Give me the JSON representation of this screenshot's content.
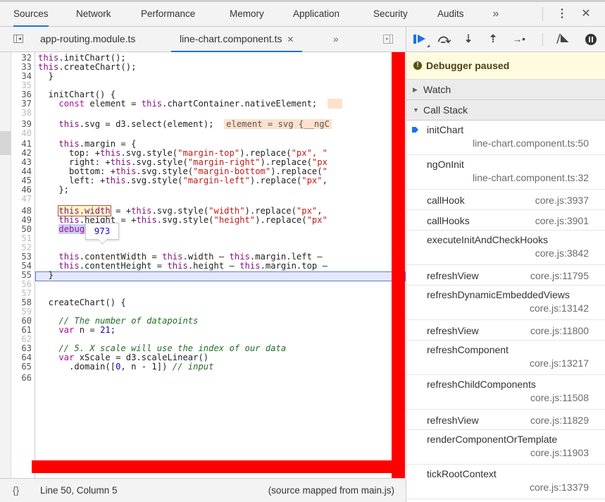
{
  "top_tabs": [
    {
      "label": "Sources",
      "active": true
    },
    {
      "label": "Network",
      "active": false
    },
    {
      "label": "Performance",
      "active": false
    },
    {
      "label": "Memory",
      "active": false
    },
    {
      "label": "Application",
      "active": false
    },
    {
      "label": "Security",
      "active": false
    },
    {
      "label": "Audits",
      "active": false
    }
  ],
  "top_more": "»",
  "top_menu": "⋮",
  "top_close": "✕",
  "file_tabs": [
    {
      "label": "app-routing.module.ts",
      "active": false
    },
    {
      "label": "line-chart.component.ts",
      "active": true,
      "close": "✕"
    }
  ],
  "file_more": "»",
  "editor": {
    "lines": [
      {
        "n": "32",
        "dim": false
      },
      {
        "n": "33",
        "dim": false
      },
      {
        "n": "34",
        "dim": false
      },
      {
        "n": "35",
        "dim": true
      },
      {
        "n": "36",
        "dim": false
      },
      {
        "n": "37",
        "dim": false
      },
      {
        "n": "38",
        "dim": true
      },
      {
        "n": "39",
        "dim": false
      },
      {
        "n": "40",
        "dim": true
      },
      {
        "n": "41",
        "dim": false
      },
      {
        "n": "42",
        "dim": false
      },
      {
        "n": "43",
        "dim": false
      },
      {
        "n": "44",
        "dim": false
      },
      {
        "n": "45",
        "dim": false
      },
      {
        "n": "46",
        "dim": false
      },
      {
        "n": "47",
        "dim": true
      },
      {
        "n": "48",
        "dim": false
      },
      {
        "n": "49",
        "dim": false
      },
      {
        "n": "50",
        "dim": false
      },
      {
        "n": "51",
        "dim": true
      },
      {
        "n": "52",
        "dim": true
      },
      {
        "n": "53",
        "dim": false
      },
      {
        "n": "54",
        "dim": false
      },
      {
        "n": "55",
        "dim": false
      },
      {
        "n": "56",
        "dim": true
      },
      {
        "n": "57",
        "dim": true
      },
      {
        "n": "58",
        "dim": false
      },
      {
        "n": "59",
        "dim": true
      },
      {
        "n": "60",
        "dim": false
      },
      {
        "n": "61",
        "dim": false
      },
      {
        "n": "62",
        "dim": true
      },
      {
        "n": "63",
        "dim": false
      },
      {
        "n": "64",
        "dim": false
      },
      {
        "n": "65",
        "dim": false
      },
      {
        "n": "66",
        "dim": false
      }
    ],
    "code": {
      "l32": "    this.initChart();",
      "l33": "    this.createChart();",
      "l34": "  }",
      "l36": "  initChart() {",
      "l37_a": "    const element = this.chartContainer.nativeElement;",
      "l37_val": "  ",
      "l39_a": "    this.svg = d3.select(element);",
      "l39_val": "element = svg {__ngC",
      "l41": "    this.margin = {",
      "l42_a": "      top: +this.svg.style(",
      "l42_s": "\"margin-top\"",
      "l42_b": ").replace(",
      "l42_s2": "\"px\", \"",
      "l43_a": "      right: +this.svg.style(",
      "l43_s": "\"margin-right\"",
      "l43_b": ").replace(",
      "l43_s2": "\"px",
      "l44_a": "      bottom: +this.svg.style(",
      "l44_s": "\"margin-bottom\"",
      "l44_b": ").replace(",
      "l44_s2": "\"",
      "l45_a": "      left: +this.svg.style(",
      "l45_s": "\"margin-left\"",
      "l45_b": ").replace(",
      "l45_s2": "\"px\"",
      "l45_c": ",",
      "l46": "    };",
      "l48_hover": "this.width",
      "l48_a": " = +this.svg.style(",
      "l48_s": "\"width\"",
      "l48_b": ").replace(",
      "l48_s2": "\"px\"",
      "l48_c": ", ",
      "l49_a": "    this.height = +this.svg.style(",
      "l49_s": "\"height\"",
      "l49_b": ").replace(",
      "l49_s2": "\"px\"",
      "l50": "debugger",
      "l53": "    this.contentWidth = this.width - this.margin.left - ",
      "l54": "    this.contentHeight = this.height - this.margin.top - ",
      "l55": "  }",
      "l58": "  createChart() {",
      "l60": "    // The number of datapoints",
      "l61_a": "    var n = ",
      "l61_n": "21",
      "l61_b": ";",
      "l63": "    // 5. X scale will use the index of our data",
      "l64": "    var xScale = d3.scaleLinear()",
      "l65_a": "      .domain([",
      "l65_n": "0",
      "l65_b": ", n - 1]) ",
      "l65_c": "// input"
    },
    "tooltip_value": "973"
  },
  "status": {
    "braces": "{}",
    "position": "Line 50, Column 5",
    "source_map": "(source mapped from main.js)"
  },
  "debugger": {
    "paused_message": "Debugger paused",
    "watch_label": "Watch",
    "callstack_label": "Call Stack",
    "frames": [
      {
        "name": "initChart",
        "loc": "line-chart.component.ts:50",
        "current": true,
        "wrap": true
      },
      {
        "name": "ngOnInit",
        "loc": "line-chart.component.ts:32",
        "current": false,
        "wrap": true
      },
      {
        "name": "callHook",
        "loc": "core.js:3937",
        "current": false,
        "wrap": false
      },
      {
        "name": "callHooks",
        "loc": "core.js:3901",
        "current": false,
        "wrap": false
      },
      {
        "name": "executeInitAndCheckHooks",
        "loc": "core.js:3842",
        "current": false,
        "wrap": true
      },
      {
        "name": "refreshView",
        "loc": "core.js:11795",
        "current": false,
        "wrap": false
      },
      {
        "name": "refreshDynamicEmbeddedViews",
        "loc": "core.js:13142",
        "current": false,
        "wrap": true
      },
      {
        "name": "refreshView",
        "loc": "core.js:11800",
        "current": false,
        "wrap": false
      },
      {
        "name": "refreshComponent",
        "loc": "core.js:13217",
        "current": false,
        "wrap": true
      },
      {
        "name": "refreshChildComponents",
        "loc": "core.js:11508",
        "current": false,
        "wrap": true
      },
      {
        "name": "refreshView",
        "loc": "core.js:11829",
        "current": false,
        "wrap": false
      },
      {
        "name": "renderComponentOrTemplate",
        "loc": "core.js:11903",
        "current": false,
        "wrap": true
      },
      {
        "name": "tickRootContext",
        "loc": "core.js:13379",
        "current": false,
        "wrap": true
      }
    ]
  },
  "colors": {
    "accent": "#1a73e8",
    "annotation_red": "#ff0000",
    "paused_banner": "#fffbe0"
  }
}
